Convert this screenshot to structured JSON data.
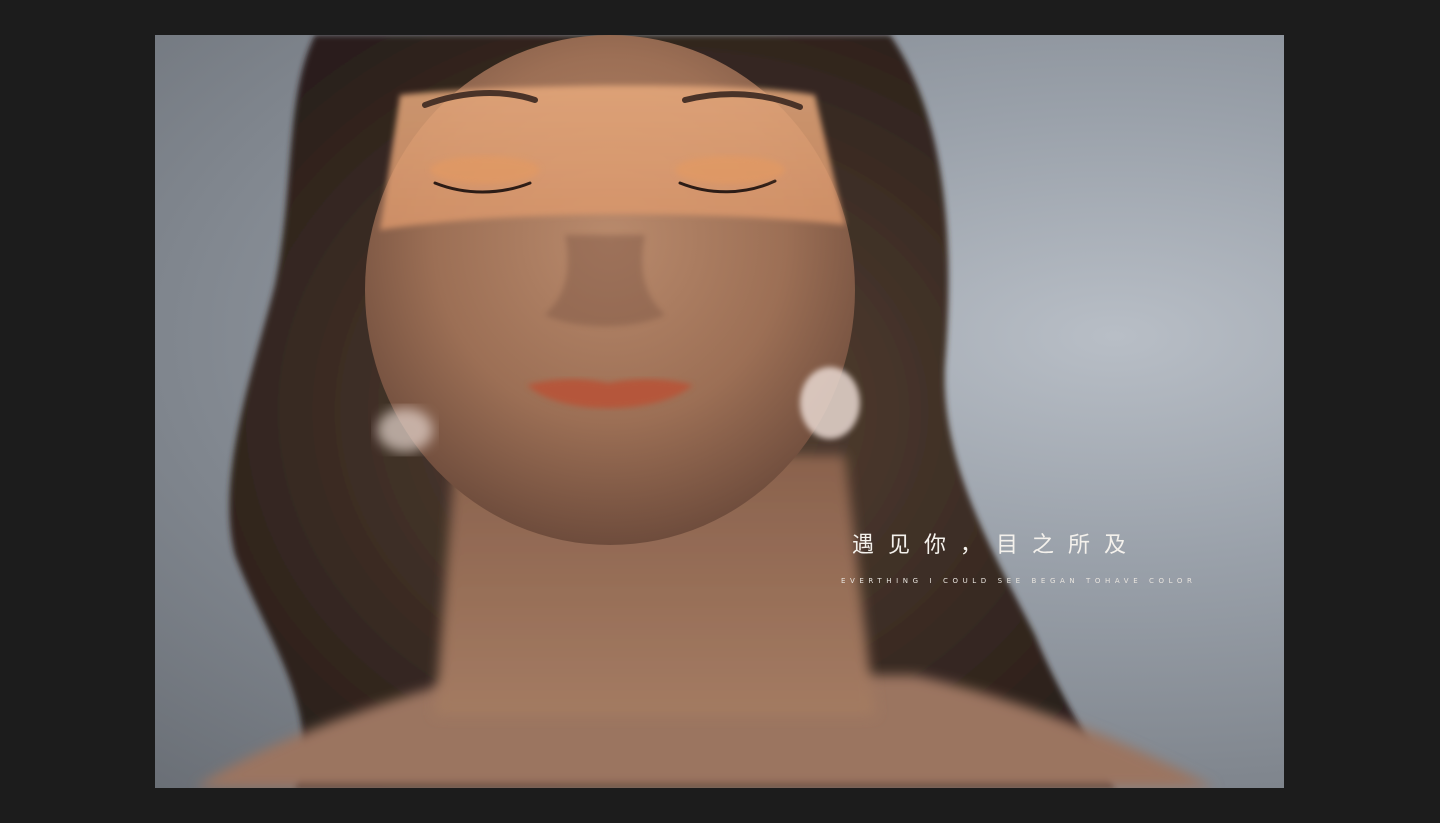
{
  "photo": {
    "subject": "woman-portrait"
  },
  "caption": {
    "chinese": "遇见你，目之所及",
    "english": "EVERTHING I COULD SEE BEGAN TOHAVE COLOR"
  },
  "colors": {
    "background": "#1c1c1c",
    "caption_text": "#f4f1ec"
  }
}
